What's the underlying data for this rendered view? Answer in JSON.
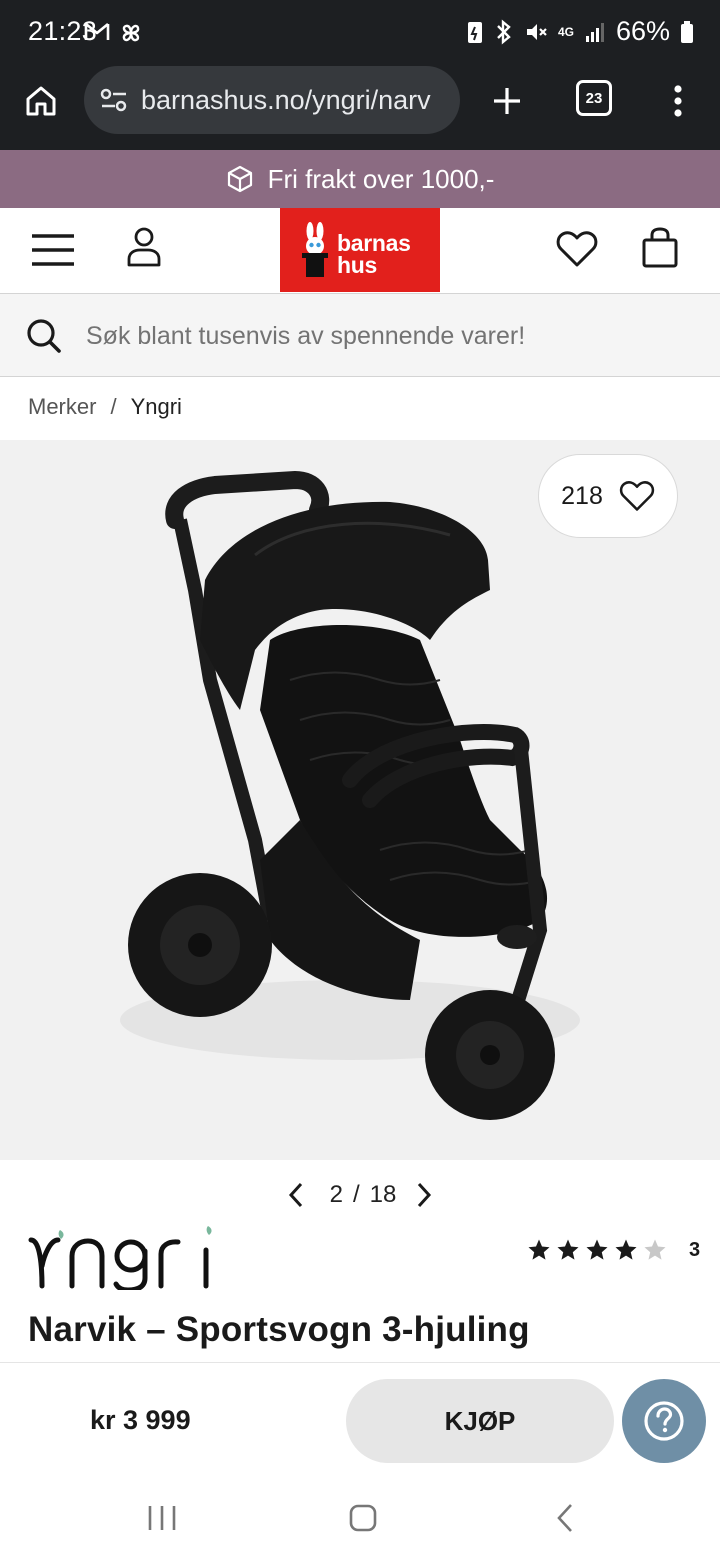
{
  "status_bar": {
    "time": "21:23",
    "signal": "4G",
    "battery": "66%"
  },
  "browser": {
    "url": "barnashus.no/yngri/narv",
    "tab_count": "23"
  },
  "promo": {
    "text": "Fri frakt over 1000,-"
  },
  "header": {
    "logo_line1": "barnas",
    "logo_line2": "hus"
  },
  "search": {
    "placeholder": "Søk blant tusenvis av spennende varer!"
  },
  "breadcrumb": {
    "items": [
      "Merker",
      "Yngri"
    ],
    "separator": "/"
  },
  "gallery": {
    "favorites_count": "218",
    "current_image": "2",
    "total_images": "18",
    "separator": "/"
  },
  "product": {
    "brand": "Yngri",
    "rating": 4,
    "max_rating": 5,
    "review_count": "3",
    "title": "Narvik – Sportsvogn 3-hjuling",
    "price": "kr 3 999",
    "buy_label": "KJØP"
  },
  "colors": {
    "promo_bg": "#8b6b82",
    "logo_red": "#e2201c",
    "help_button": "#6f8fa6"
  }
}
